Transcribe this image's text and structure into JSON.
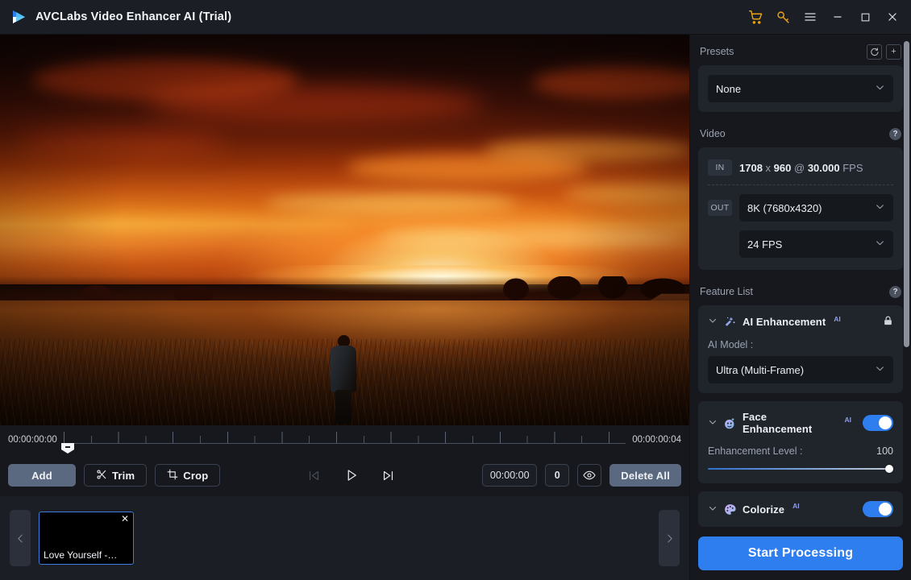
{
  "titlebar": {
    "app_title": "AVCLabs Video Enhancer AI (Trial)",
    "logo_icon": "play-logo-icon",
    "buttons": [
      {
        "name": "cart-icon",
        "glyph": "🛒",
        "color": "#e8a317"
      },
      {
        "name": "key-icon",
        "glyph": "🔑",
        "color": "#e8a317"
      },
      {
        "name": "menu-icon",
        "glyph": "☰",
        "color": "#d8dce3"
      },
      {
        "name": "minimize-icon",
        "glyph": "−",
        "color": "#d8dce3"
      },
      {
        "name": "maximize-icon",
        "glyph": "□",
        "color": "#d8dce3"
      },
      {
        "name": "close-icon",
        "glyph": "✕",
        "color": "#d8dce3"
      }
    ]
  },
  "preview": {
    "description": "Sunset video frame: silhouette of a person standing in a tall grass field, sun setting on horizon behind trees and houses, dramatic orange and red clouds"
  },
  "timeline": {
    "start_timecode": "00:00:00:00",
    "end_timecode": "00:00:00:04",
    "playhead_position": "00:00:00:00"
  },
  "controls": {
    "add_label": "Add",
    "trim_label": "Trim",
    "crop_label": "Crop",
    "trim_icon": "scissors-icon",
    "crop_icon": "crop-icon",
    "prev_frame_icon": "skip-previous-icon",
    "play_icon": "play-icon",
    "next_frame_icon": "skip-next-icon",
    "current_time_value": "00:00:00",
    "frame_value": "0",
    "preview_icon": "eye-icon",
    "delete_all_label": "Delete All"
  },
  "strip": {
    "prev_icon": "chevron-left-icon",
    "next_icon": "chevron-right-icon",
    "items": [
      {
        "label": "Love Yourself -…",
        "close_icon": "close-icon"
      }
    ]
  },
  "presets": {
    "title": "Presets",
    "refresh_icon": "refresh-icon",
    "refresh_glyph": "↻",
    "add_icon": "plus-icon",
    "add_glyph": "+",
    "selected": "None",
    "chevron_icon": "chevron-down-icon"
  },
  "video": {
    "title": "Video",
    "help_icon": "help-icon",
    "help_glyph": "?",
    "in_tag": "IN",
    "in_width": "1708",
    "in_x": "x",
    "in_height": "960",
    "in_at": "@",
    "in_fps_value": "30.000",
    "in_fps_unit": "FPS",
    "out_tag": "OUT",
    "out_resolution": "8K (7680x4320)",
    "out_fps": "24 FPS"
  },
  "features": {
    "title": "Feature List",
    "help_icon": "help-icon",
    "help_glyph": "?",
    "items": [
      {
        "name": "AI Enhancement",
        "icon": "magic-wand-icon",
        "ai_badge": "AI",
        "state_icon": "lock-icon",
        "state_glyph": "🔒",
        "sub_label": "AI Model :",
        "model_value": "Ultra (Multi-Frame)"
      },
      {
        "name": "Face Enhancement",
        "icon": "face-icon",
        "ai_badge": "AI",
        "toggle_on": true,
        "level_label": "Enhancement Level :",
        "level_value": "100"
      },
      {
        "name": "Colorize",
        "icon": "palette-icon",
        "ai_badge": "AI",
        "toggle_on": true
      }
    ]
  },
  "footer": {
    "start_label": "Start Processing"
  },
  "colors": {
    "accent_blue": "#2f7ef0",
    "gold": "#e8a317",
    "panel_bg": "#20242b",
    "app_bg": "#16181d",
    "titlebar_bg": "#1b1e24",
    "button_slate": "#5a6880"
  }
}
